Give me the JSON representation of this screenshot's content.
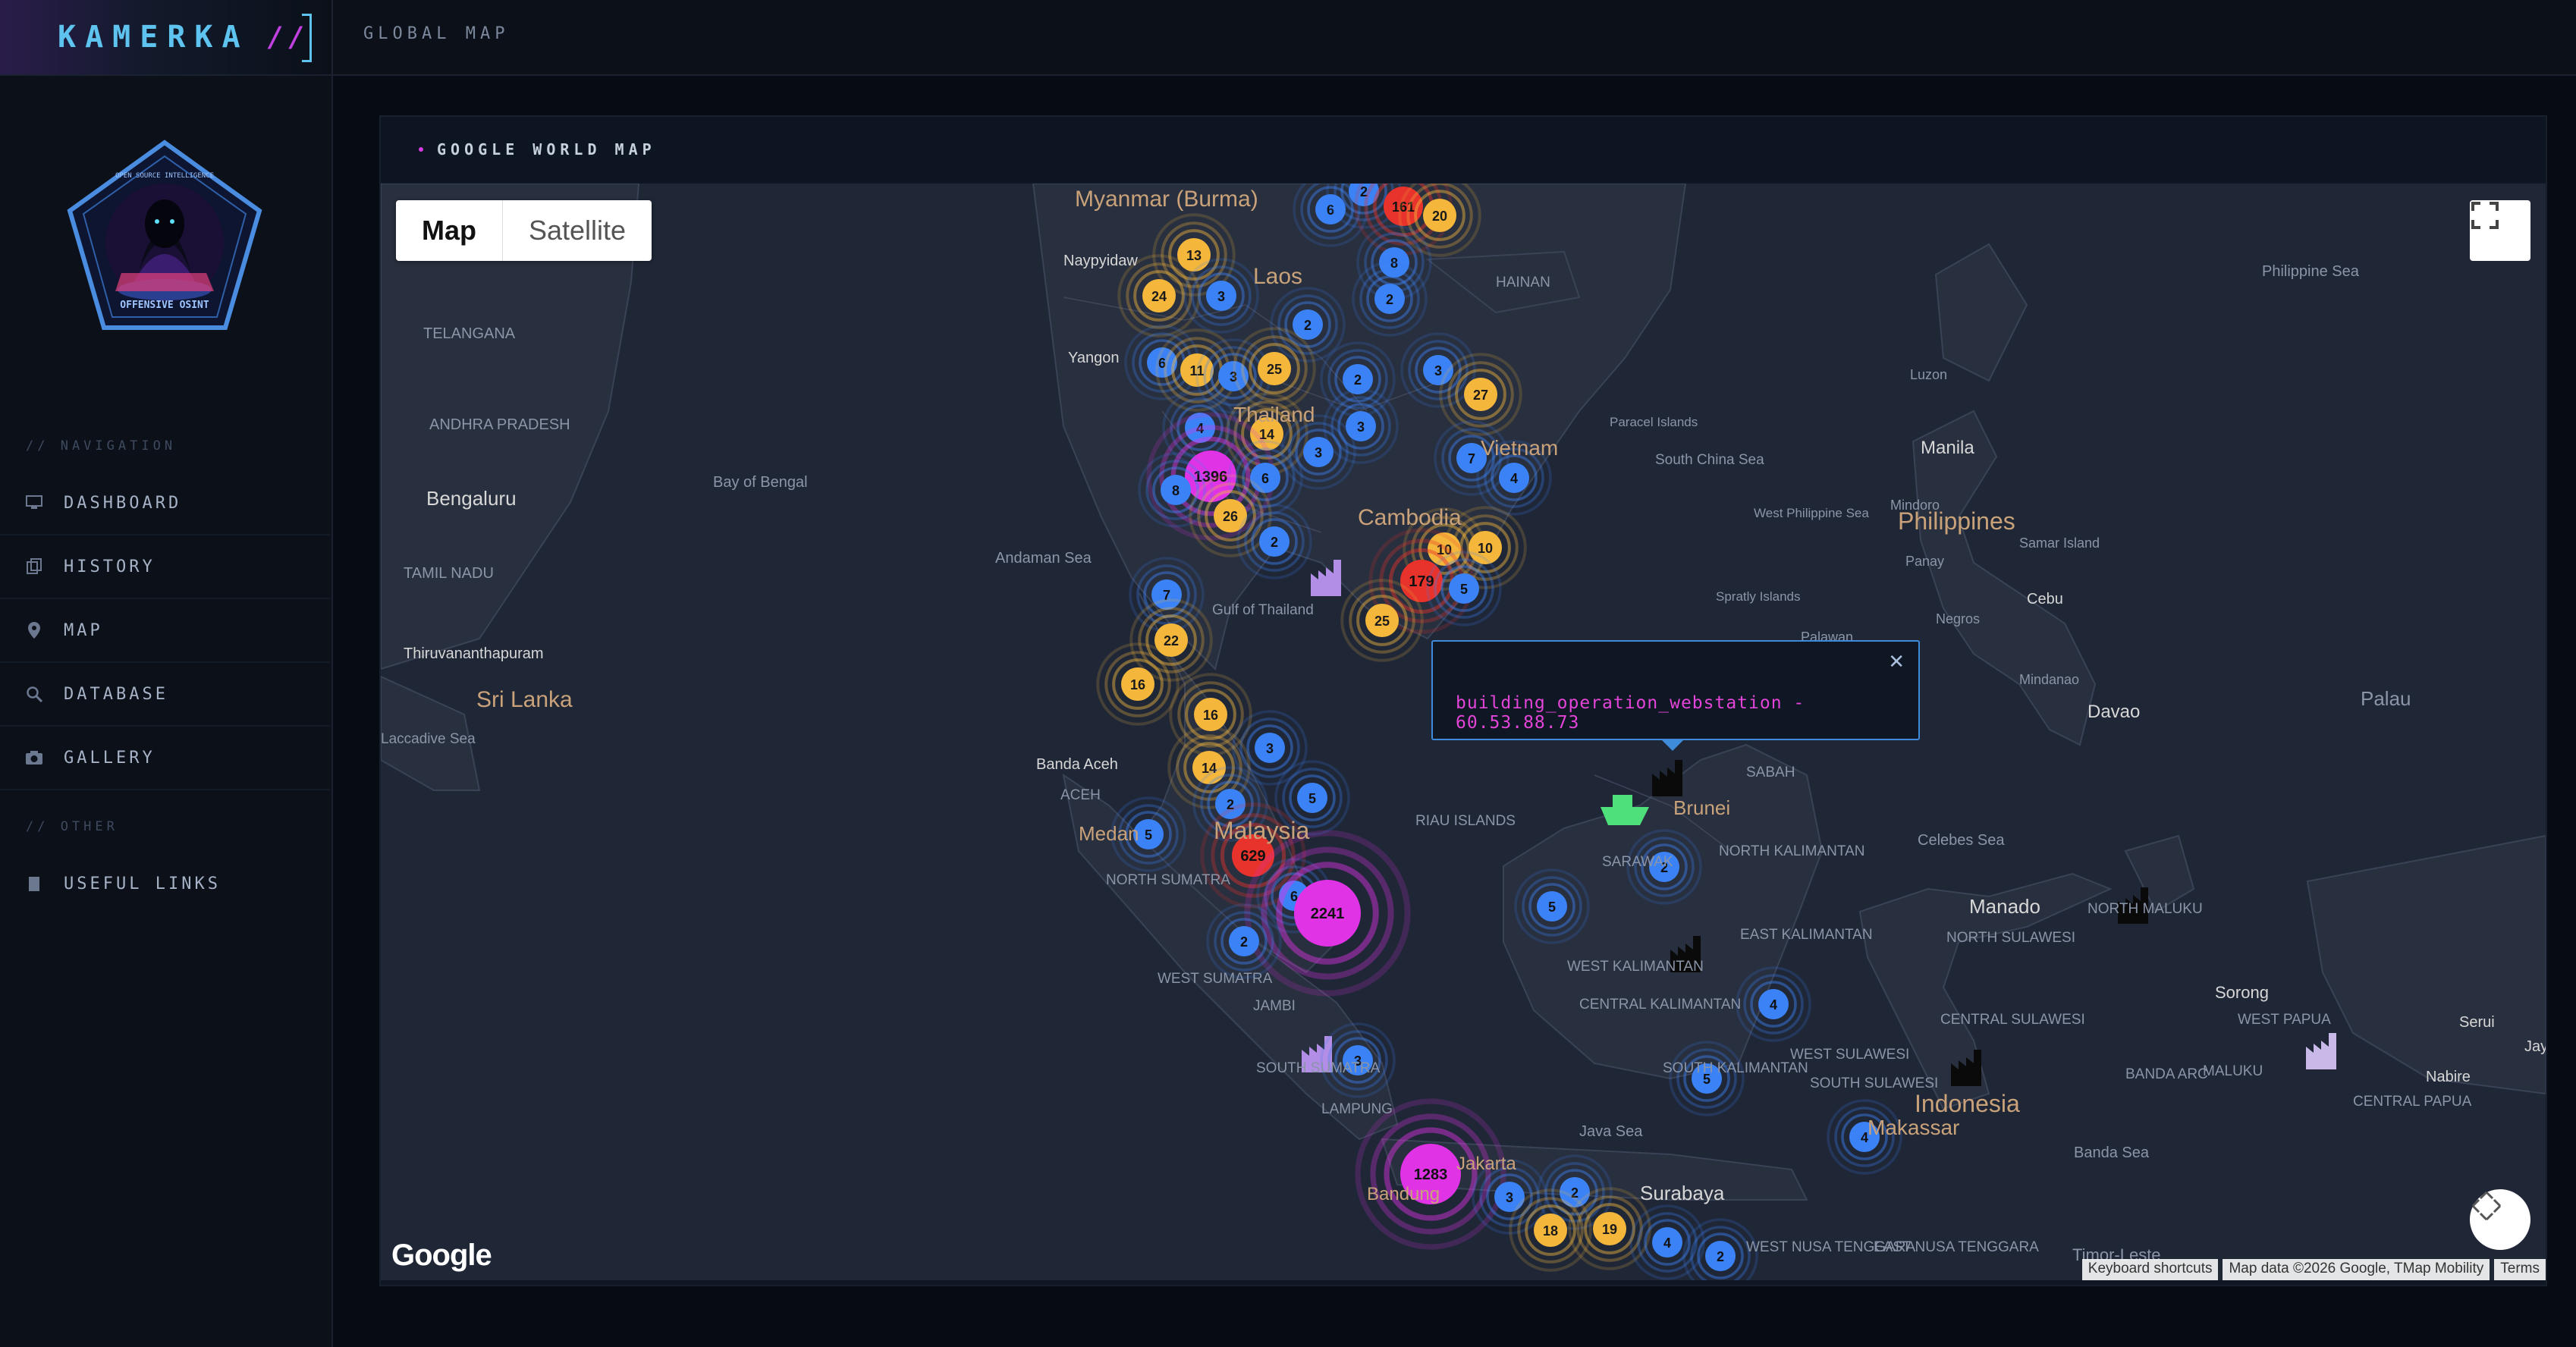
{
  "brand": {
    "name": "KAMERKA",
    "slashes": "//"
  },
  "topbar": {
    "title": "GLOBAL MAP"
  },
  "logo": {
    "caption": "OFFENSIVE OSINT",
    "ring_text": "OPEN SOURCE INTELLIGENCE"
  },
  "nav": {
    "section1": "// NAVIGATION",
    "items": [
      {
        "label": "DASHBOARD",
        "icon": "monitor-icon"
      },
      {
        "label": "HISTORY",
        "icon": "history-icon"
      },
      {
        "label": "MAP",
        "icon": "map-pin-icon"
      },
      {
        "label": "DATABASE",
        "icon": "search-icon"
      },
      {
        "label": "GALLERY",
        "icon": "camera-icon"
      }
    ],
    "section2": "// OTHER",
    "other_items": [
      {
        "label": "USEFUL LINKS",
        "icon": "book-icon"
      }
    ]
  },
  "panel": {
    "title": "GOOGLE WORLD MAP"
  },
  "map": {
    "type_control": {
      "map": "Map",
      "satellite": "Satellite",
      "selected": "Map"
    },
    "popup": {
      "text": "building_operation_webstation - 60.53.88.73"
    },
    "attribution": [
      "Keyboard shortcuts",
      "Map data ©2026 Google, TMap Mobility",
      "Terms"
    ],
    "google_logo": "Google",
    "colors": {
      "blue": "#3b82f6",
      "yellow": "#f4b73c",
      "red": "#e7332b",
      "magenta": "#e033e6",
      "building": "#0a0a0a",
      "building_alt": "#b28ee6",
      "ship": "#4ee07a"
    },
    "labels": [
      "Myanmar (Burma)",
      "Naypyidaw",
      "Laos",
      "Yangon",
      "Thailand",
      "Cambodia",
      "Vietnam",
      "Bay of Bengal",
      "Andaman Sea",
      "Gulf of Thailand",
      "HAINAN",
      "Paracel Islands",
      "South China Sea",
      "Spratly Islands",
      "West Philippine Sea",
      "Manila",
      "Philippines",
      "Mindoro",
      "Panay",
      "Samar Island",
      "Negros",
      "Cebu",
      "Palawan",
      "Mindanao",
      "Davao",
      "Palau",
      "Philippine Sea",
      "Luzon",
      "TELANGANA",
      "ANDHRA PRADESH",
      "Bengaluru",
      "TAMIL NADU",
      "Thiruvananthapuram",
      "Sri Lanka",
      "Laccadive Sea",
      "Banda Aceh",
      "ACEH",
      "Medan",
      "NORTH SUMATRA",
      "Malaysia",
      "WEST SUMATRA",
      "JAMBI",
      "SOUTH SUMATRA",
      "LAMPUNG",
      "RIAU ISLANDS",
      "SARAWAK",
      "SABAH",
      "Brunei",
      "NORTH KALIMANTAN",
      "EAST KALIMANTAN",
      "WEST KALIMANTAN",
      "CENTRAL KALIMANTAN",
      "SOUTH KALIMANTAN",
      "Celebes Sea",
      "Manado",
      "NORTH SULAWESI",
      "CENTRAL SULAWESI",
      "WEST SULAWESI",
      "SOUTH SULAWESI",
      "Makassar",
      "Indonesia",
      "Java Sea",
      "Surabaya",
      "Jakarta",
      "Bandung",
      "EAST NUSA TENGGARA",
      "WEST NUSA TENGGARA",
      "Timor-Leste",
      "Banda Sea",
      "BANDA ARC",
      "NORTH MALUKU",
      "MALUKU",
      "Sorong",
      "WEST PAPUA",
      "CENTRAL PAPUA",
      "Nabire",
      "Serui",
      "Jayapura"
    ],
    "clusters": [
      {
        "count": "6",
        "color": "blue"
      },
      {
        "count": "2",
        "color": "blue"
      },
      {
        "count": "161",
        "color": "red"
      },
      {
        "count": "20",
        "color": "yellow"
      },
      {
        "count": "13",
        "color": "yellow"
      },
      {
        "count": "8",
        "color": "blue"
      },
      {
        "count": "24",
        "color": "yellow"
      },
      {
        "count": "3",
        "color": "blue"
      },
      {
        "count": "2",
        "color": "blue"
      },
      {
        "count": "2",
        "color": "blue"
      },
      {
        "count": "6",
        "color": "blue"
      },
      {
        "count": "11",
        "color": "yellow"
      },
      {
        "count": "3",
        "color": "blue"
      },
      {
        "count": "25",
        "color": "yellow"
      },
      {
        "count": "2",
        "color": "blue"
      },
      {
        "count": "3",
        "color": "blue"
      },
      {
        "count": "27",
        "color": "yellow"
      },
      {
        "count": "4",
        "color": "blue"
      },
      {
        "count": "14",
        "color": "yellow"
      },
      {
        "count": "3",
        "color": "blue"
      },
      {
        "count": "3",
        "color": "blue"
      },
      {
        "count": "7",
        "color": "blue"
      },
      {
        "count": "4",
        "color": "blue"
      },
      {
        "count": "1396",
        "color": "magenta"
      },
      {
        "count": "8",
        "color": "blue"
      },
      {
        "count": "6",
        "color": "blue"
      },
      {
        "count": "26",
        "color": "yellow"
      },
      {
        "count": "2",
        "color": "blue"
      },
      {
        "count": "10",
        "color": "yellow"
      },
      {
        "count": "10",
        "color": "yellow"
      },
      {
        "count": "179",
        "color": "red"
      },
      {
        "count": "5",
        "color": "blue"
      },
      {
        "count": "7",
        "color": "blue"
      },
      {
        "count": "25",
        "color": "yellow"
      },
      {
        "count": "22",
        "color": "yellow"
      },
      {
        "count": "16",
        "color": "yellow"
      },
      {
        "count": "16",
        "color": "yellow"
      },
      {
        "count": "3",
        "color": "blue"
      },
      {
        "count": "14",
        "color": "yellow"
      },
      {
        "count": "2",
        "color": "blue"
      },
      {
        "count": "5",
        "color": "blue"
      },
      {
        "count": "5",
        "color": "blue"
      },
      {
        "count": "629",
        "color": "red"
      },
      {
        "count": "6",
        "color": "blue"
      },
      {
        "count": "2241",
        "color": "magenta"
      },
      {
        "count": "2",
        "color": "blue"
      },
      {
        "count": "2",
        "color": "blue"
      },
      {
        "count": "5",
        "color": "blue"
      },
      {
        "count": "4",
        "color": "blue"
      },
      {
        "count": "3",
        "color": "blue"
      },
      {
        "count": "5",
        "color": "blue"
      },
      {
        "count": "4",
        "color": "blue"
      },
      {
        "count": "1283",
        "color": "magenta"
      },
      {
        "count": "3",
        "color": "blue"
      },
      {
        "count": "2",
        "color": "blue"
      },
      {
        "count": "18",
        "color": "yellow"
      },
      {
        "count": "19",
        "color": "yellow"
      },
      {
        "count": "4",
        "color": "blue"
      },
      {
        "count": "2",
        "color": "blue"
      }
    ]
  }
}
